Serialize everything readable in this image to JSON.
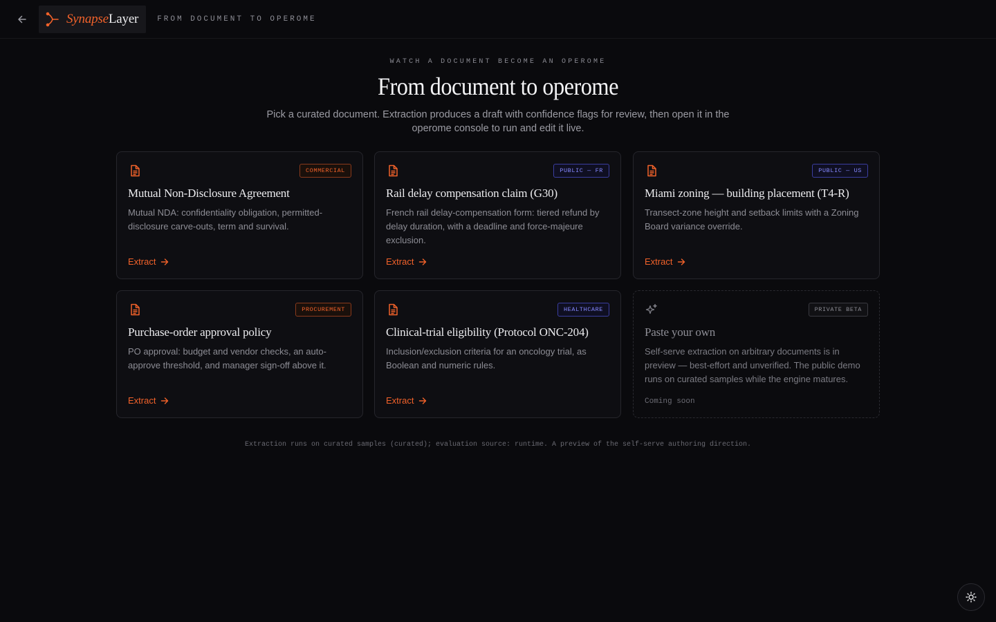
{
  "nav": {
    "brand_a": "Synapse",
    "brand_b": "Layer",
    "crumb": "FROM DOCUMENT TO OPEROME"
  },
  "hero": {
    "eyebrow": "WATCH A DOCUMENT BECOME AN OPEROME",
    "title": "From document to operome",
    "lede": "Pick a curated document. Extraction produces a draft with confidence flags for review, then open it in the operome console to run and edit it live."
  },
  "cards": [
    {
      "tag": "COMMERCIAL",
      "title": "Mutual Non-Disclosure Agreement",
      "desc": "Mutual NDA: confidentiality obligation, permitted-disclosure carve-outs, term and survival.",
      "action": "Extract"
    },
    {
      "tag": "PUBLIC — FR",
      "title": "Rail delay compensation claim (G30)",
      "desc": "French rail delay-compensation form: tiered refund by delay duration, with a deadline and force-majeure exclusion.",
      "action": "Extract"
    },
    {
      "tag": "PUBLIC — US",
      "title": "Miami zoning — building placement (T4-R)",
      "desc": "Transect-zone height and setback limits with a Zoning Board variance override.",
      "action": "Extract"
    },
    {
      "tag": "PROCUREMENT",
      "title": "Purchase-order approval policy",
      "desc": "PO approval: budget and vendor checks, an auto-approve threshold, and manager sign-off above it.",
      "action": "Extract"
    },
    {
      "tag": "HEALTHCARE",
      "title": "Clinical-trial eligibility (Protocol ONC-204)",
      "desc": "Inclusion/exclusion criteria for an oncology trial, as Boolean and numeric rules.",
      "action": "Extract"
    },
    {
      "tag": "PRIVATE BETA",
      "title": "Paste your own",
      "desc": "Self-serve extraction on arbitrary documents is in preview — best-effort and unverified. The public demo runs on curated samples while the engine matures.",
      "status": "Coming soon"
    }
  ],
  "footnote": "Extraction runs on curated samples (curated); evaluation source: runtime. A preview of the self-serve authoring direction.",
  "colors": {
    "accent": "#f2622a",
    "tag_blue": "#8588ff",
    "background": "#0a0a0d"
  },
  "icons": [
    "arrow-left-icon",
    "synapse-logo-icon",
    "document-icon",
    "sparkles-icon",
    "arrow-right-icon",
    "sun-icon"
  ]
}
